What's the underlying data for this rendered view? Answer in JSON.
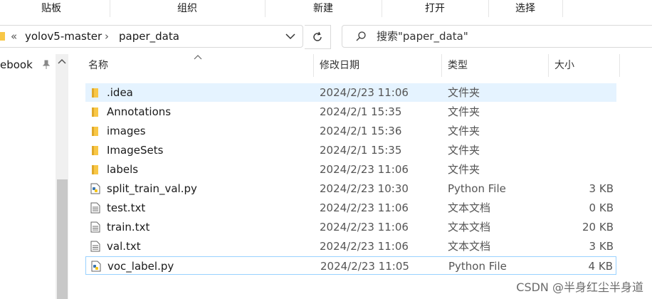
{
  "ribbon": {
    "groups": [
      "贴板",
      "组织",
      "新建",
      "打开",
      "选择"
    ]
  },
  "address": {
    "overflow": "«",
    "crumbs": [
      "yolov5-master",
      "paper_data"
    ],
    "separator": "›"
  },
  "search": {
    "placeholder": "搜索\"paper_data\""
  },
  "nav": {
    "item_label": "ebook"
  },
  "columns": {
    "name": "名称",
    "date": "修改日期",
    "type": "类型",
    "size": "大小"
  },
  "files": [
    {
      "name": ".idea",
      "date": "2024/2/23 11:06",
      "type": "文件夹",
      "size": "",
      "icon": "folder-icon"
    },
    {
      "name": "Annotations",
      "date": "2024/2/1 15:35",
      "type": "文件夹",
      "size": "",
      "icon": "folder-icon"
    },
    {
      "name": "images",
      "date": "2024/2/1 15:36",
      "type": "文件夹",
      "size": "",
      "icon": "folder-icon"
    },
    {
      "name": "ImageSets",
      "date": "2024/2/1 15:35",
      "type": "文件夹",
      "size": "",
      "icon": "folder-icon"
    },
    {
      "name": "labels",
      "date": "2024/2/23 11:06",
      "type": "文件夹",
      "size": "",
      "icon": "folder-icon"
    },
    {
      "name": "split_train_val.py",
      "date": "2024/2/23 10:30",
      "type": "Python File",
      "size": "3 KB",
      "icon": "python-file-icon"
    },
    {
      "name": "test.txt",
      "date": "2024/2/23 11:06",
      "type": "文本文档",
      "size": "0 KB",
      "icon": "text-file-icon"
    },
    {
      "name": "train.txt",
      "date": "2024/2/23 11:06",
      "type": "文本文档",
      "size": "20 KB",
      "icon": "text-file-icon"
    },
    {
      "name": "val.txt",
      "date": "2024/2/23 11:06",
      "type": "文本文档",
      "size": "3 KB",
      "icon": "text-file-icon"
    },
    {
      "name": "voc_label.py",
      "date": "2024/2/23 11:05",
      "type": "Python File",
      "size": "4 KB",
      "icon": "python-file-icon"
    }
  ],
  "watermark": "CSDN @半身红尘半身道",
  "colors": {
    "folder": "#f8c746",
    "selection": "#e5f3ff",
    "focus_border": "#99d1ff"
  }
}
